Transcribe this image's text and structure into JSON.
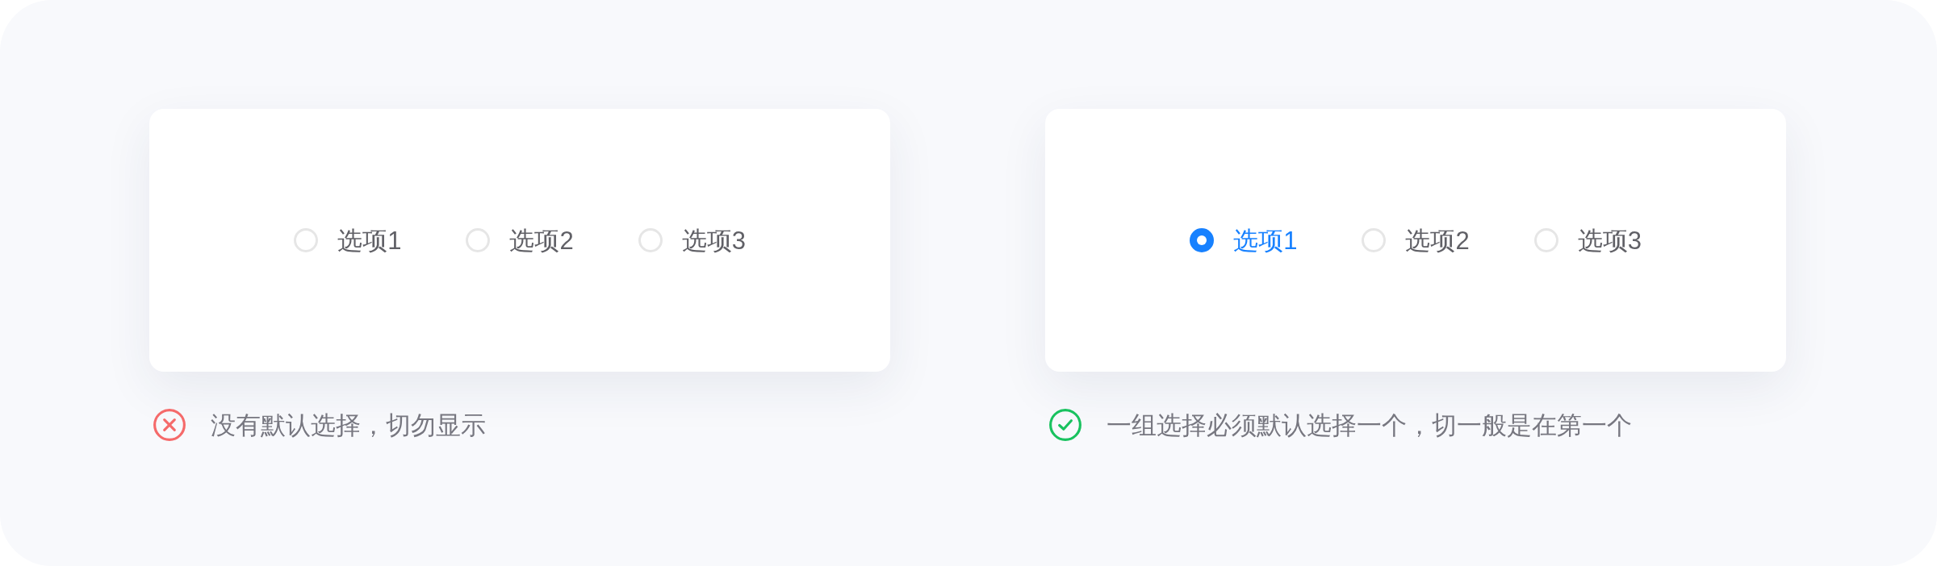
{
  "panels": [
    {
      "options": [
        {
          "label": "选项1",
          "selected": false
        },
        {
          "label": "选项2",
          "selected": false
        },
        {
          "label": "选项3",
          "selected": false
        }
      ],
      "caption": {
        "kind": "wrong",
        "text": "没有默认选择，切勿显示"
      }
    },
    {
      "options": [
        {
          "label": "选项1",
          "selected": true
        },
        {
          "label": "选项2",
          "selected": false
        },
        {
          "label": "选项3",
          "selected": false
        }
      ],
      "caption": {
        "kind": "right",
        "text": "一组选择必须默认选择一个，切一般是在第一个"
      }
    }
  ]
}
